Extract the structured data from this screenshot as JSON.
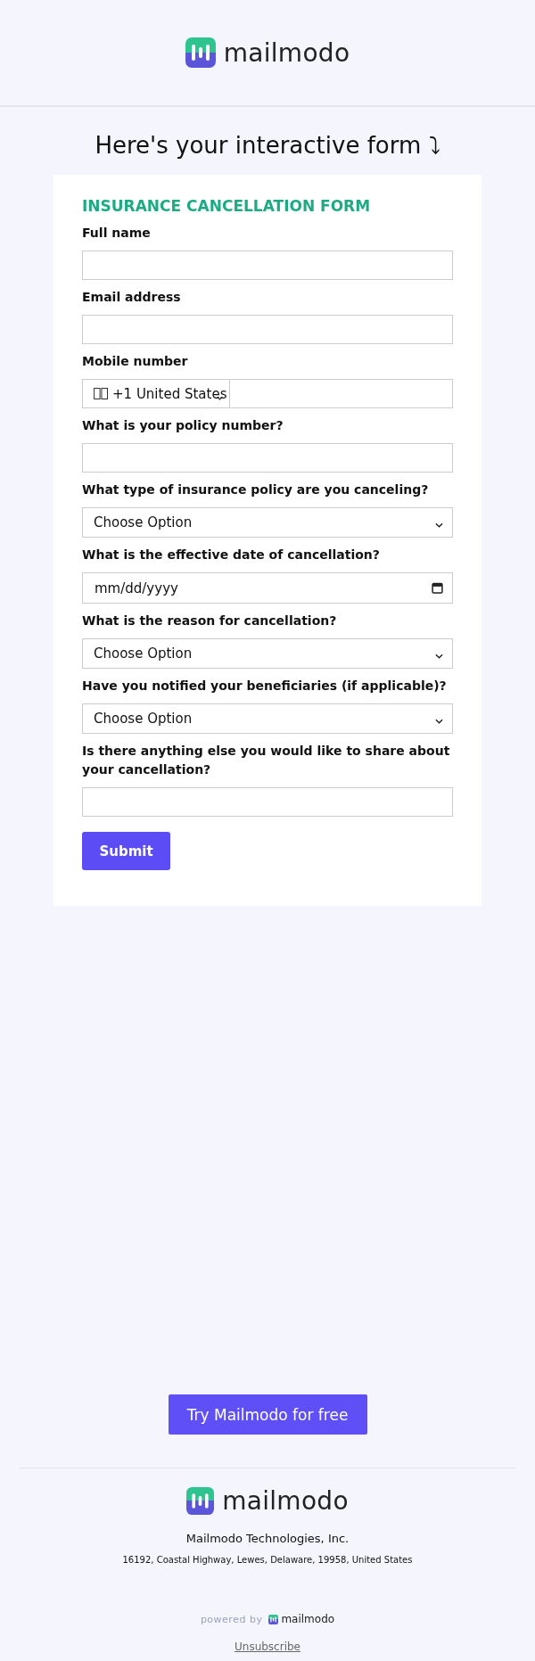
{
  "header": {
    "brand": "mailmodo"
  },
  "intro": {
    "title": "Here's your interactive form ⤵"
  },
  "form": {
    "heading": "INSURANCE CANCELLATION FORM",
    "fields": [
      {
        "kind": "text",
        "label": "Full name"
      },
      {
        "kind": "text",
        "label": "Email address"
      },
      {
        "kind": "phone",
        "label": "Mobile number",
        "country": "+1 United States"
      },
      {
        "kind": "text",
        "label": "What is your policy number?"
      },
      {
        "kind": "select",
        "label": "What type of insurance policy are you canceling?",
        "value": "Choose Option"
      },
      {
        "kind": "date",
        "label": "What is the effective date of cancellation?",
        "placeholder": "mm/dd/yyyy"
      },
      {
        "kind": "select",
        "label": "What is the reason for cancellation?",
        "value": "Choose Option"
      },
      {
        "kind": "select",
        "label": "Have you notified your beneficiaries (if applicable)?",
        "value": "Choose Option"
      },
      {
        "kind": "text",
        "label": "Is there anything else you would like to share about your cancellation?"
      }
    ],
    "submit": "Submit"
  },
  "cta": {
    "label": "Try Mailmodo for free"
  },
  "footer": {
    "brand": "mailmodo",
    "company": "Mailmodo Technologies, Inc.",
    "address": "16192, Coastal Highway, Lewes, Delaware, 19958, United States",
    "powered_by": "powered by",
    "powered_brand": "mailmodo",
    "unsubscribe": "Unsubscribe"
  }
}
